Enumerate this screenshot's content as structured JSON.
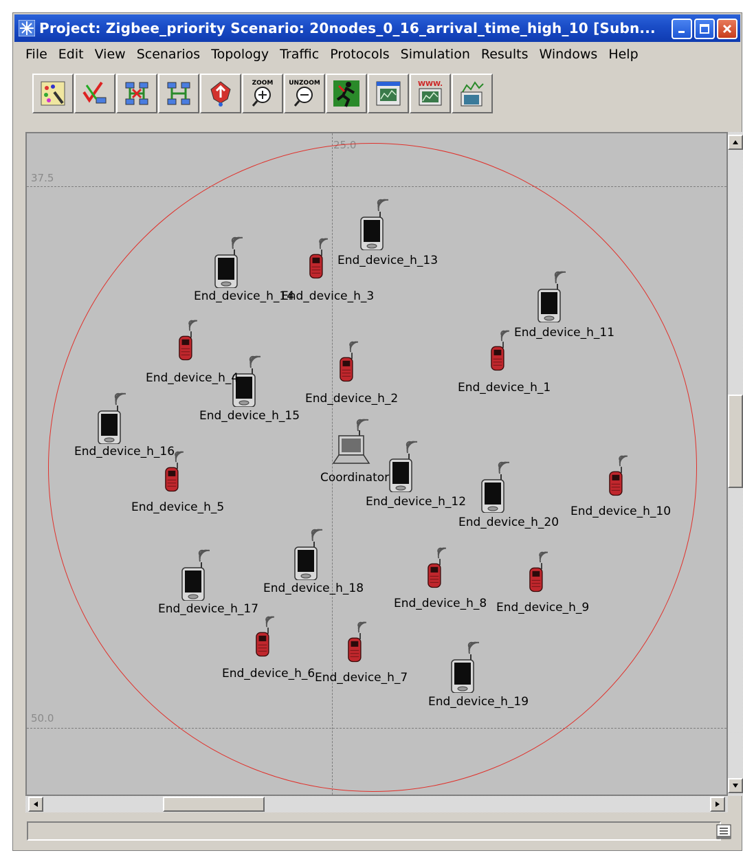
{
  "window": {
    "title": "Project: Zigbee_priority Scenario: 20nodes_0_16_arrival_time_high_10  [Subn..."
  },
  "menu": [
    "File",
    "Edit",
    "View",
    "Scenarios",
    "Topology",
    "Traffic",
    "Protocols",
    "Simulation",
    "Results",
    "Windows",
    "Help"
  ],
  "toolbar": {
    "zoom_label": "ZOOM",
    "unzoom_label": "UNZOOM",
    "web_label": "WWW."
  },
  "canvas": {
    "grid_labels": {
      "top_x": "25.0",
      "y_top": "37.5",
      "y_bottom": "50.0"
    },
    "circle_color": "#e0302a"
  },
  "nodes": {
    "coordinator": "Coordinator",
    "h1": "End_device_h_1",
    "h2": "End_device_h_2",
    "h3": "End_device_h_3",
    "h4": "End_device_h_4",
    "h5": "End_device_h_5",
    "h6": "End_device_h_6",
    "h7": "End_device_h_7",
    "h8": "End_device_h_8",
    "h9": "End_device_h_9",
    "h10": "End_device_h_10",
    "h11": "End_device_h_11",
    "h12": "End_device_h_12",
    "h13": "End_device_h_13",
    "h14": "End_device_h_14",
    "h15": "End_device_h_15",
    "h16": "End_device_h_16",
    "h17": "End_device_h_17",
    "h18": "End_device_h_18",
    "h19": "End_device_h_19",
    "h20": "End_device_h_20"
  },
  "icons": {
    "red_device": "red-phone-icon",
    "black_device": "pda-icon",
    "coordinator": "laptop-icon",
    "red_color": "#c0272d",
    "black_color": "#1c1c1c"
  }
}
